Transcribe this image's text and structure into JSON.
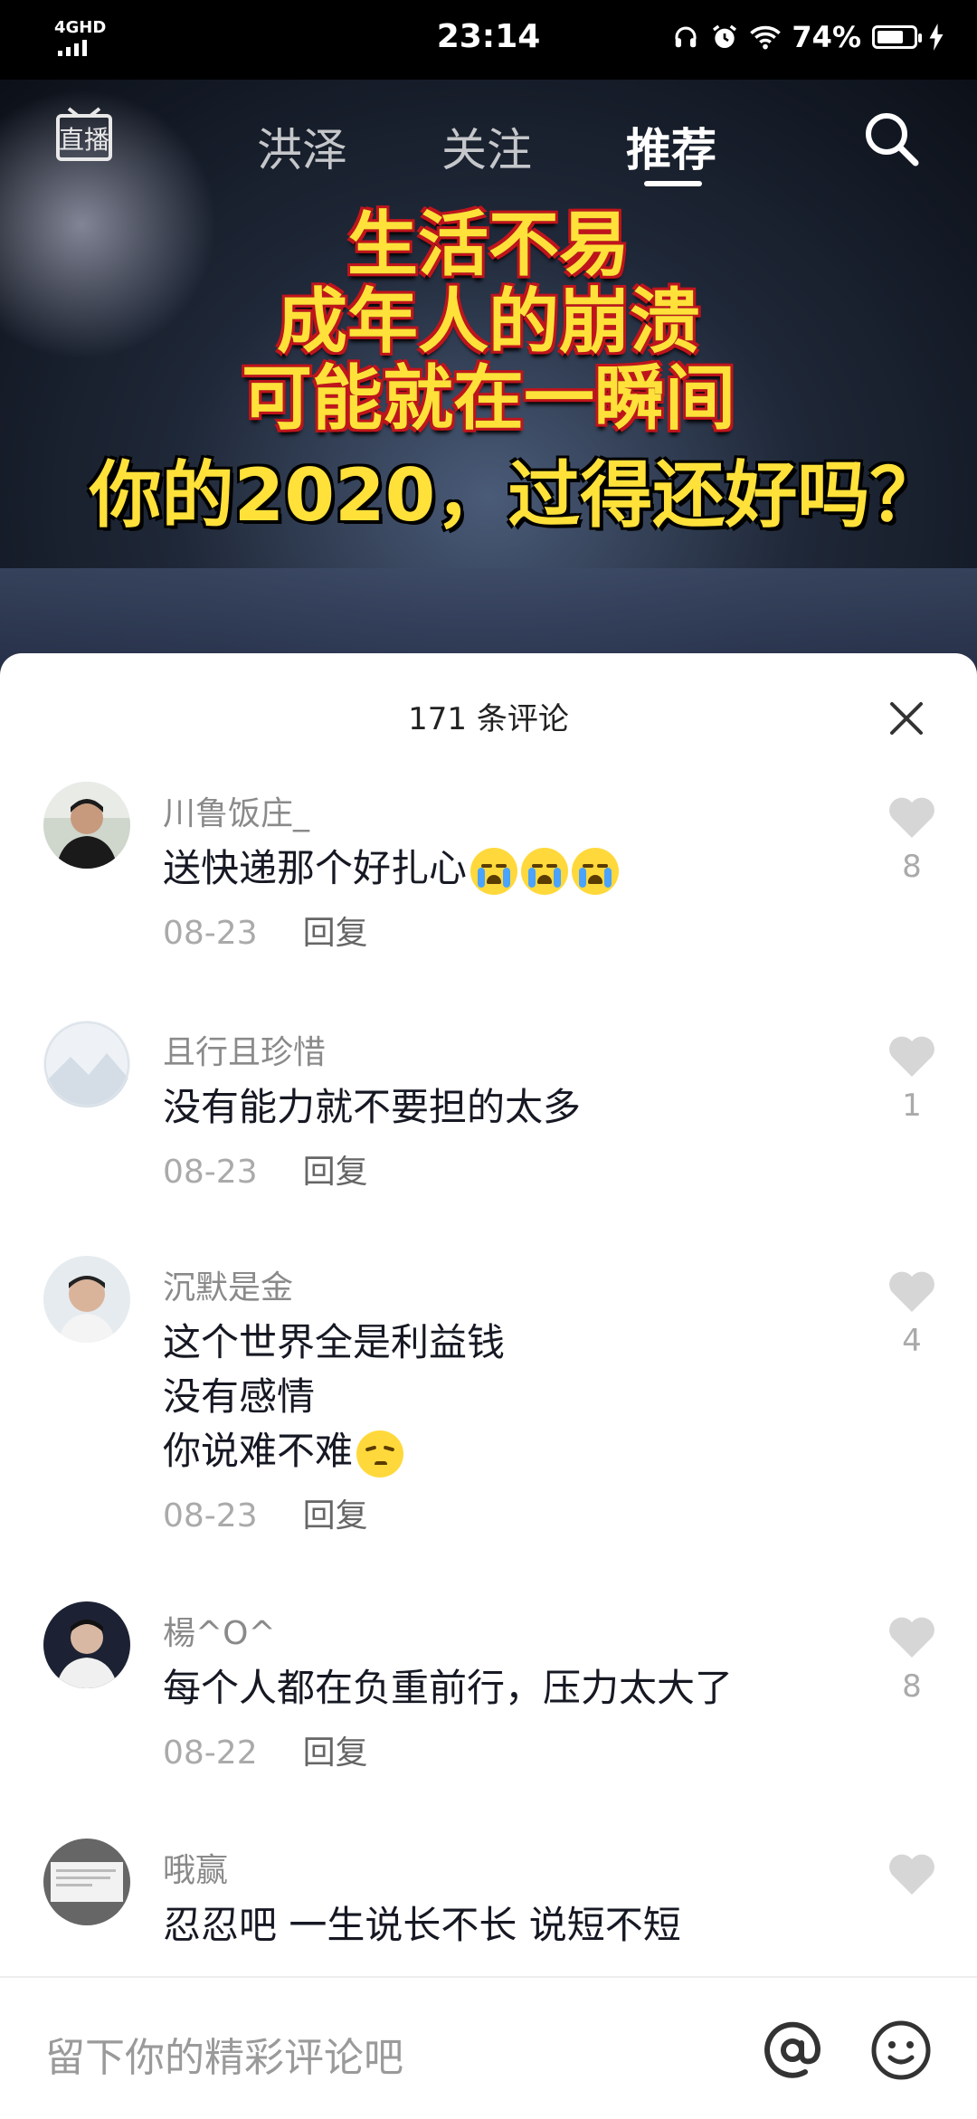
{
  "status_bar": {
    "network": "4GHD",
    "time": "23:14",
    "battery_text": "74%",
    "battery_level": 0.74
  },
  "top_nav": {
    "live_icon": "live-stream-icon",
    "tabs": [
      {
        "label": "洪泽",
        "active": false
      },
      {
        "label": "关注",
        "active": false
      },
      {
        "label": "推荐",
        "active": true
      }
    ],
    "search_icon": "search-icon"
  },
  "video_caption": {
    "line1": "生活不易",
    "line2": "成年人的崩溃",
    "line3": "可能就在一瞬间",
    "line4": "你的2020，过得还好吗？"
  },
  "comments_sheet": {
    "title": "171 条评论",
    "close_icon": "close-icon",
    "reply_label": "回复",
    "comments": [
      {
        "user": "川鲁饭庄_",
        "text": "送快递那个好扎心",
        "emoji": [
          "crying-face",
          "crying-face",
          "crying-face"
        ],
        "date": "08-23",
        "likes": "8"
      },
      {
        "user": "且行且珍惜",
        "text": "没有能力就不要担的太多",
        "date": "08-23",
        "likes": "1"
      },
      {
        "user": "沉默是金",
        "text": "这个世界全是利益钱\n没有感情\n你说难不难",
        "emoji": [
          "smirking-face"
        ],
        "date": "08-23",
        "likes": "4"
      },
      {
        "user": "楊^O^",
        "text": "每个人都在负重前行，压力太大了",
        "date": "08-22",
        "likes": "8"
      },
      {
        "user": "哦赢",
        "text": "忍忍吧 一生说长不长 说短不短",
        "date": "",
        "likes": ""
      }
    ]
  },
  "input_bar": {
    "placeholder": "留下你的精彩评论吧",
    "at_icon": "at-icon",
    "emoji_icon": "emoji-icon"
  },
  "colors": {
    "caption_yellow": "#ffe13a",
    "caption_outline": "#c0141c",
    "sheet_bg": "#ffffff",
    "username_gray": "#8a8a8a",
    "text_dark": "#161823",
    "heart_gray": "#d6d6d6"
  }
}
